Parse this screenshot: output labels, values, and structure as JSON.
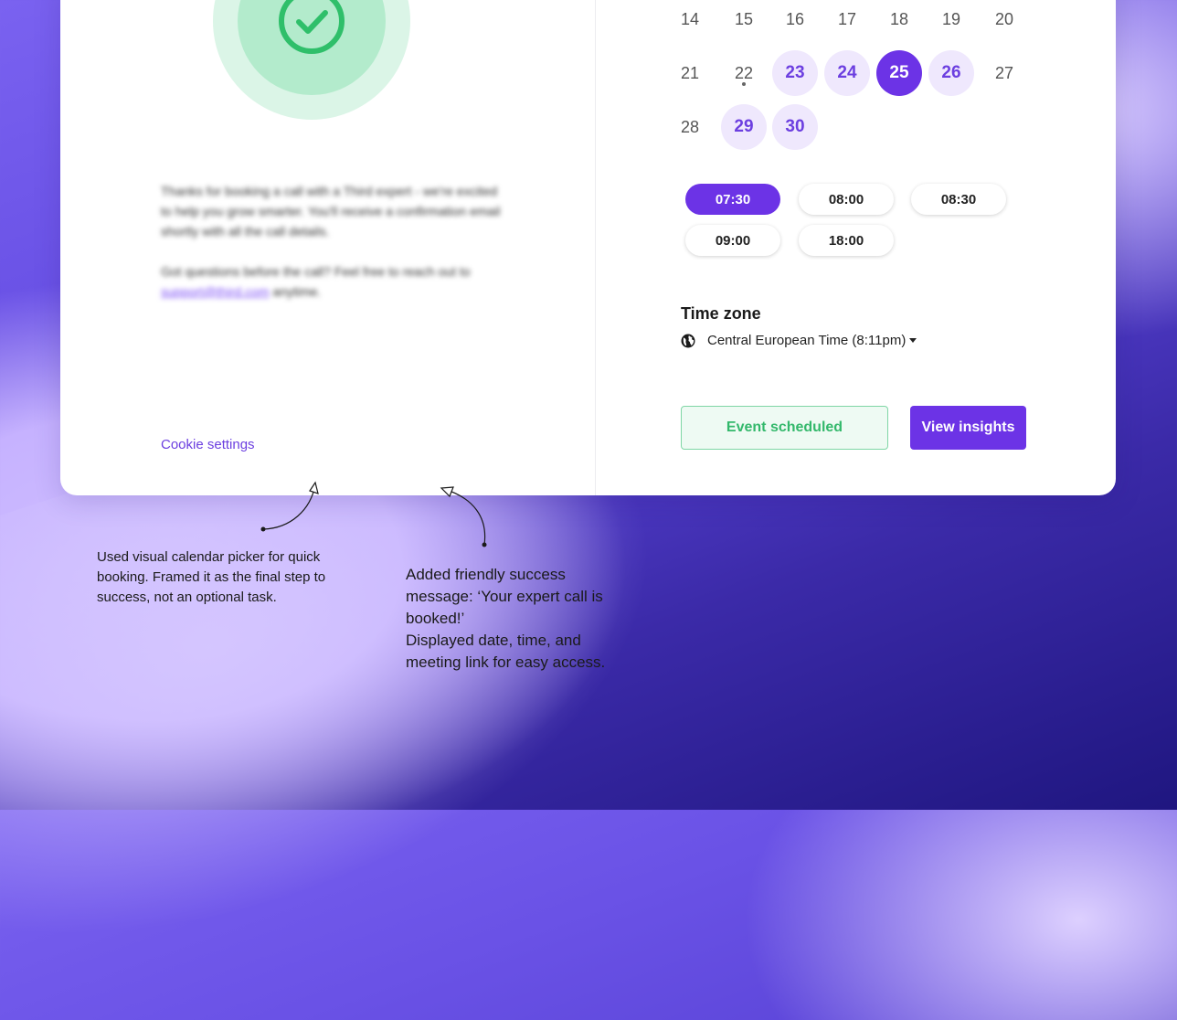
{
  "confirmation": {
    "message_line1": "Thanks for booking a call with a Third expert - we're excited to help you grow smarter. You'll receive a confirmation email shortly with all the call details.",
    "message_line2_prefix": "Got questions before the call? Feel free to reach out to ",
    "support_email": "support@third.com",
    "message_line2_suffix": " anytime.",
    "cookie_settings": "Cookie settings"
  },
  "calendar": {
    "rows": [
      [
        {
          "d": "14",
          "s": "plain"
        },
        {
          "d": "15",
          "s": "plain"
        },
        {
          "d": "16",
          "s": "plain"
        },
        {
          "d": "17",
          "s": "plain"
        },
        {
          "d": "18",
          "s": "plain"
        },
        {
          "d": "19",
          "s": "plain"
        },
        {
          "d": "20",
          "s": "plain"
        }
      ],
      [
        {
          "d": "21",
          "s": "plain"
        },
        {
          "d": "22",
          "s": "today"
        },
        {
          "d": "23",
          "s": "avail"
        },
        {
          "d": "24",
          "s": "avail"
        },
        {
          "d": "25",
          "s": "sel"
        },
        {
          "d": "26",
          "s": "avail"
        },
        {
          "d": "27",
          "s": "plain"
        }
      ],
      [
        {
          "d": "28",
          "s": "plain"
        },
        {
          "d": "29",
          "s": "avail"
        },
        {
          "d": "30",
          "s": "avail"
        }
      ]
    ]
  },
  "time_slots": [
    {
      "label": "07:30",
      "selected": true
    },
    {
      "label": "08:00",
      "selected": false
    },
    {
      "label": "08:30",
      "selected": false
    },
    {
      "label": "09:00",
      "selected": false
    },
    {
      "label": "18:00",
      "selected": false
    }
  ],
  "timezone": {
    "title": "Time zone",
    "value": "Central European Time (8:11pm)",
    "icon": "globe-icon"
  },
  "buttons": {
    "event_scheduled": "Event scheduled",
    "view_insights": "View insights"
  },
  "annotations": {
    "note1": "Used visual calendar picker for quick booking. Framed it as the final step to success, not an optional task.",
    "note2_line1": "Added friendly success message: ‘Your expert call is booked!’",
    "note2_line2": "Displayed date, time, and meeting link for easy access."
  },
  "colors": {
    "accent": "#6c33e6",
    "success": "#33b86b"
  }
}
